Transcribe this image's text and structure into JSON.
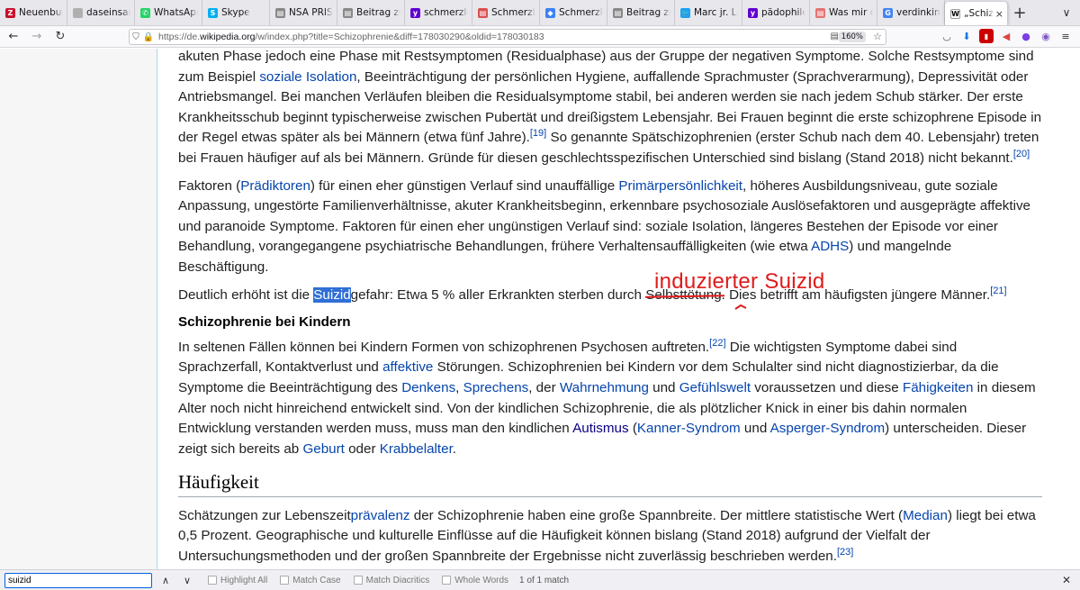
{
  "tabs": [
    {
      "label": "Neuenburg",
      "fav": "Z",
      "color": "#c8102e"
    },
    {
      "label": "daseinsanalyse",
      "fav": "",
      "color": "#b0b0b0"
    },
    {
      "label": "WhatsApp",
      "fav": "✆",
      "color": "#25d366"
    },
    {
      "label": "Skype",
      "fav": "S",
      "color": "#00aff0"
    },
    {
      "label": "NSA PRISM",
      "fav": "▤",
      "color": "#888888"
    },
    {
      "label": "Beitrag zu P",
      "fav": "▤",
      "color": "#888888"
    },
    {
      "label": "schmerzlos",
      "fav": "y",
      "color": "#6001d2"
    },
    {
      "label": "Schmerzlos",
      "fav": "▤",
      "color": "#d94f4f"
    },
    {
      "label": "Schmerzlos",
      "fav": "◆",
      "color": "#3b82f6"
    },
    {
      "label": "Beitrag zu P",
      "fav": "▤",
      "color": "#888888"
    },
    {
      "label": "Marc jr. Lan",
      "fav": "🐦",
      "color": "#1da1f2"
    },
    {
      "label": "pädophile s",
      "fav": "y",
      "color": "#6001d2"
    },
    {
      "label": "Was mir die",
      "fav": "▤",
      "color": "#e57373"
    },
    {
      "label": "verdinkinde",
      "fav": "G",
      "color": "#4285f4"
    }
  ],
  "active_tab": {
    "label": "„Schizophr",
    "fav": "W"
  },
  "url": {
    "prefix": "https://de.",
    "domain": "wikipedia.org",
    "path": "/w/index.php?title=Schizophrenie&diff=178030290&oldid=178030183"
  },
  "zoom": "160%",
  "article": {
    "p1": {
      "t1": "akuten Phase jedoch eine Phase mit Restsymptomen (Residualphase) aus der Gruppe der negativen Symptome. Solche Restsymptome sind zum Beispiel ",
      "l1": "soziale Isolation",
      "t2": ", Beeinträchtigung der persönlichen Hygiene, auffallende Sprachmuster (Sprachverarmung), Depressivität oder Antriebsmangel. Bei manchen Verläufen bleiben die Residualsymptome stabil, bei anderen werden sie nach jedem Schub stärker. Der erste Krankheitsschub beginnt typischerweise zwischen Pubertät und dreißigstem Lebensjahr. Bei Frauen beginnt die erste schizophrene Episode in der Regel etwas später als bei Männern (etwa fünf Jahre).",
      "r1": "[19]",
      "t3": " So genannte Spätschizophrenien (erster Schub nach dem 40. Lebensjahr) treten bei Frauen häufiger auf als bei Männern. Gründe für diesen geschlechtsspezifischen Unterschied sind bislang (Stand 2018) nicht bekannt.",
      "r2": "[20]"
    },
    "p2": {
      "t1": "Faktoren (",
      "l1": "Prädiktoren",
      "t2": ") für einen eher günstigen Verlauf sind unauffällige ",
      "l2": "Primärpersönlichkeit",
      "t3": ", höheres Ausbildungsniveau, gute soziale Anpassung, ungestörte Familienverhältnisse, akuter Krankheitsbeginn, erkennbare psychosoziale Auslösefaktoren und ausgeprägte affektive und paranoide Symptome. Faktoren für einen eher ungünstigen Verlauf sind: soziale Isolation, längeres Bestehen der Episode vor einer Behandlung, vorangegangene psychiatrische Behandlungen, frühere Verhaltensauffälligkeiten (wie etwa ",
      "l3": "ADHS",
      "t4": ") und mangelnde Beschäftigung."
    },
    "p3": {
      "t1": "Deutlich erhöht ist die ",
      "hl": "Suizid",
      "t2": "gefahr: Etwa 5 % aller Erkrankten sterben durch ",
      "struck": "Selbsttötung",
      "t3": ". Dies betrifft am häufigsten jüngere Männer.",
      "r1": "[21]"
    },
    "annotation": "induzierter Suizid",
    "h3": "Schizophrenie bei Kindern",
    "p4": {
      "t1": "In seltenen Fällen können bei Kindern Formen von schizophrenen Psychosen auftreten.",
      "r1": "[22]",
      "t2": " Die wichtigsten Symptome dabei sind Sprachzerfall, Kontaktverlust und ",
      "l1": "affektive",
      "t3": " Störungen. Schizophrenien bei Kindern vor dem Schulalter sind nicht diagnostizierbar, da die Symptome die Beeinträchtigung des ",
      "l2": "Denkens",
      "t4": ", ",
      "l3": "Sprechens",
      "t5": ", der ",
      "l4": "Wahrnehmung",
      "t6": " und ",
      "l5": "Gefühlswelt",
      "t7": " voraussetzen und diese ",
      "l6": "Fähigkeiten",
      "t8": " in diesem Alter noch nicht hinreichend entwickelt sind. Von der kindlichen Schizophrenie, die als plötzlicher Knick in einer bis dahin normalen Entwicklung verstanden werden muss, muss man den kindlichen ",
      "l7": "Autismus",
      "t9": " (",
      "l8": "Kanner-Syndrom",
      "t10": " und ",
      "l9": "Asperger-Syndrom",
      "t11": ") unterscheiden. Dieser zeigt sich bereits ab ",
      "l10": "Geburt",
      "t12": " oder ",
      "l11": "Krabbelalter",
      "t13": "."
    },
    "h2": "Häufigkeit",
    "p5": {
      "t1": "Schätzungen zur Lebenszeit",
      "l1": "prävalenz",
      "t2": " der Schizophrenie haben eine große Spannbreite. Der mittlere statistische Wert (",
      "l2": "Median",
      "t3": ") liegt bei etwa 0,5 Prozent. Geographische und kulturelle Einflüsse auf die Häufigkeit können bislang (Stand 2018) aufgrund der Vielfalt der Untersuchungsmethoden und der großen Spannbreite der Ergebnisse nicht zuverlässig beschrieben werden.",
      "r1": "[23]"
    }
  },
  "findbar": {
    "query": "suizid",
    "highlight_all": "Highlight All",
    "match_case": "Match Case",
    "match_diacritics": "Match Diacritics",
    "whole_words": "Whole Words",
    "status": "1 of 1 match"
  },
  "colors": {
    "link": "#0645ad",
    "annotation": "#e01b1b",
    "find_highlight": "#2f6fd6"
  }
}
